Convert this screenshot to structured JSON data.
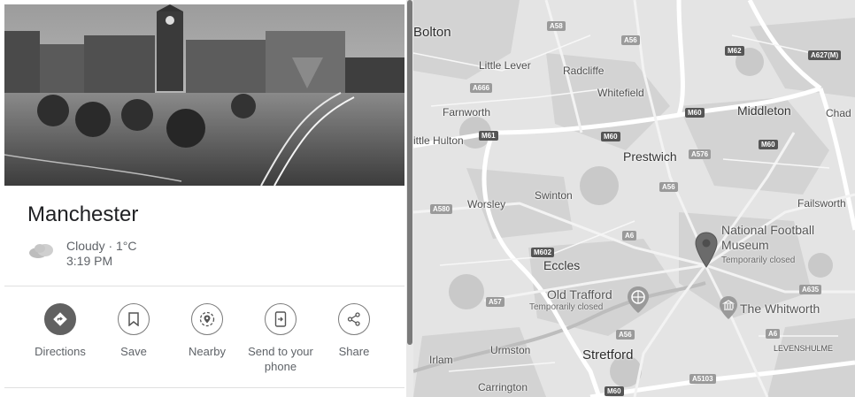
{
  "place": {
    "name": "Manchester",
    "weather": {
      "condition": "Cloudy · 1°C",
      "time": "3:19 PM"
    }
  },
  "actions": [
    {
      "label": "Directions"
    },
    {
      "label": "Save"
    },
    {
      "label": "Nearby"
    },
    {
      "label": "Send to your phone"
    },
    {
      "label": "Share"
    }
  ],
  "map": {
    "places": {
      "bolton": "Bolton",
      "little_lever": "Little Lever",
      "radcliffe": "Radcliffe",
      "whitefield": "Whitefield",
      "middleton": "Middleton",
      "chadderton": "Chad",
      "farnworth": "Farnworth",
      "little_hulton": "ittle Hulton",
      "prestwich": "Prestwich",
      "swinton": "Swinton",
      "worsley": "Worsley",
      "failsworth": "Failsworth",
      "eccles": "Eccles",
      "irlam": "Irlam",
      "urmston": "Urmston",
      "stretford": "Stretford",
      "carrington": "Carrington",
      "levenshulme": "LEVENSHULME"
    },
    "roads": {
      "a58": "A58",
      "a56_top": "A56",
      "m62": "M62",
      "a627m": "A627(M)",
      "a666": "A666",
      "m60_a": "M60",
      "m61": "M61",
      "m60_b": "M60",
      "a576": "A576",
      "m60_c": "M60",
      "a56_mid": "A56",
      "a580": "A580",
      "a6_mid": "A6",
      "m602": "M602",
      "a57": "A57",
      "a635": "A635",
      "a56_low": "A56",
      "a6_low": "A6",
      "a5103": "A5103",
      "m60_d": "M60"
    },
    "pois": {
      "museum_name": "National Football Museum",
      "museum_status": "Temporarily closed",
      "trafford_name": "Old Trafford",
      "trafford_status": "Temporarily closed",
      "whitworth_name": "The Whitworth"
    }
  }
}
